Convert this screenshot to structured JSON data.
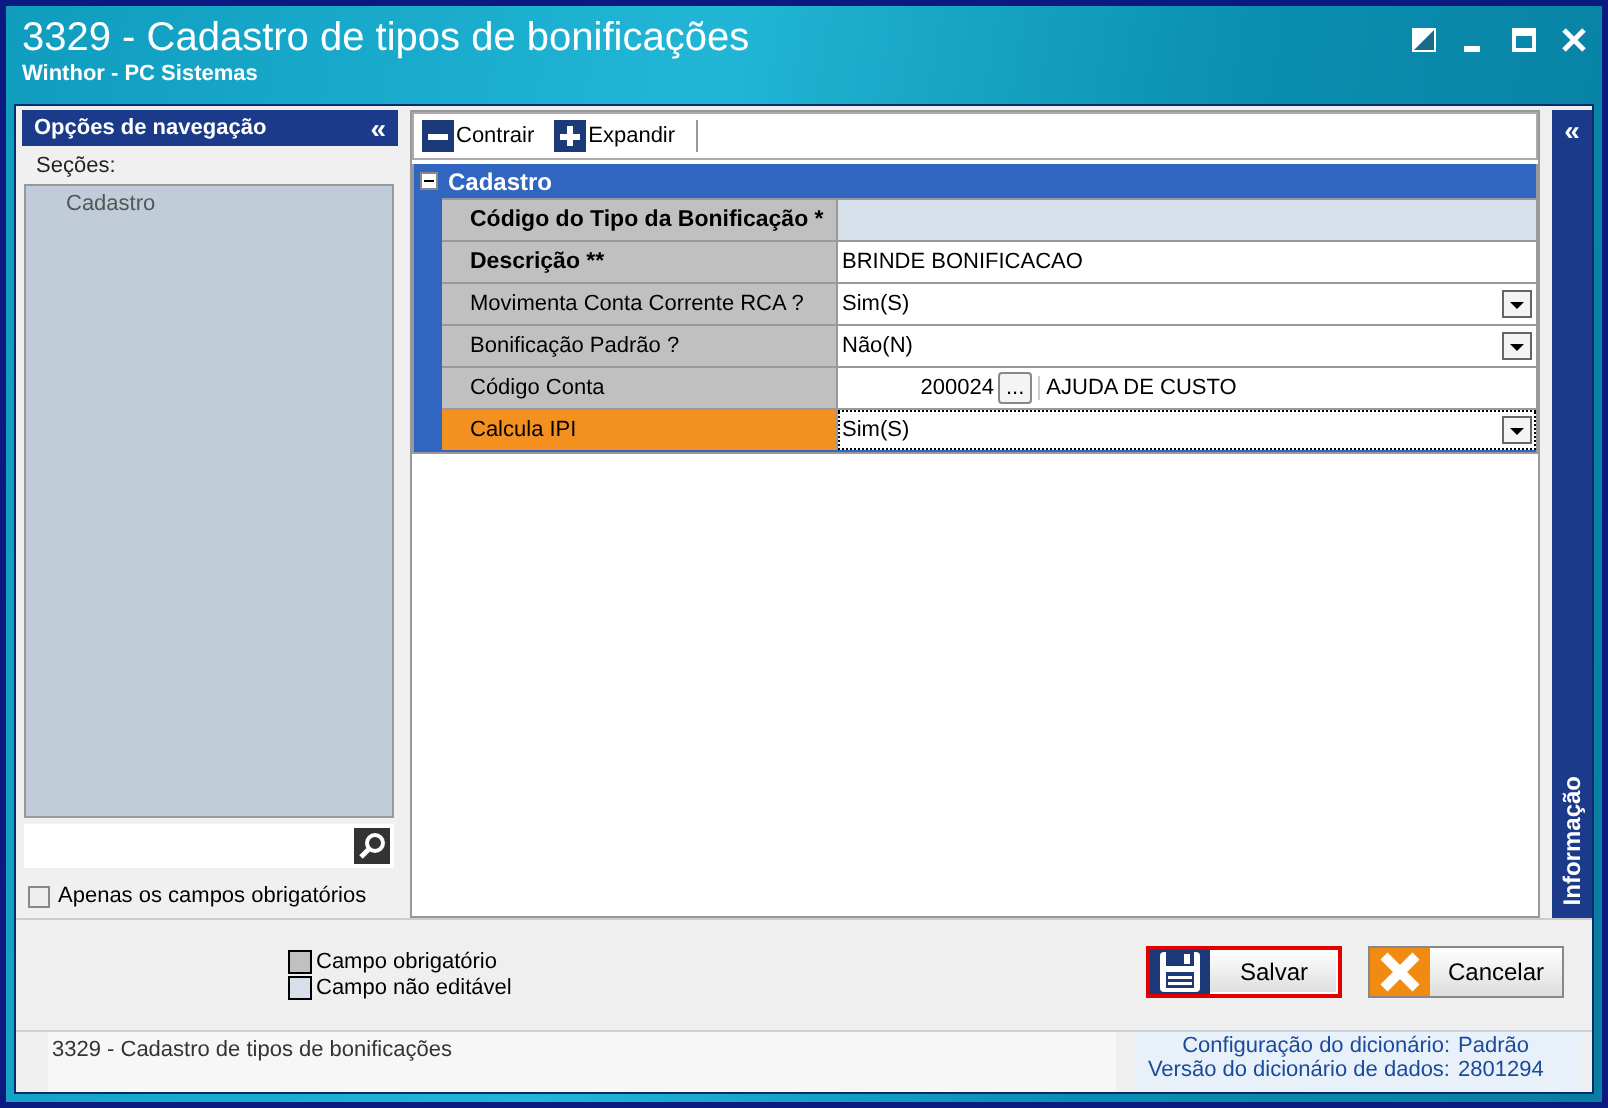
{
  "window": {
    "title": "3329 - Cadastro de tipos de bonificações",
    "subtitle": "Winthor - PC Sistemas"
  },
  "nav_panel": {
    "title": "Opções de navegação",
    "collapse": "«",
    "sections_label": "Seções:",
    "tree": [
      {
        "label": "Cadastro",
        "selected": false
      }
    ],
    "required_only": {
      "label": "Apenas os campos obrigatórios",
      "checked": false
    }
  },
  "toolbar": [
    {
      "label": "Contrair",
      "kind": "collapse"
    },
    {
      "label": "Expandir",
      "kind": "expand"
    }
  ],
  "group": {
    "title": "Cadastro",
    "expanded": true
  },
  "rows": [
    {
      "label": "Código do Tipo da Bonificação *",
      "required": true,
      "editable": false,
      "selected": false,
      "kind": "text"
    },
    {
      "label": "Descrição **",
      "value": "BRINDE BONIFICACAO",
      "required": true,
      "editable": true,
      "selected": false,
      "kind": "text"
    },
    {
      "label": "Movimenta Conta Corrente RCA ?",
      "value": "Sim(S)",
      "required": false,
      "editable": true,
      "selected": false,
      "kind": "select"
    },
    {
      "label": "Bonificação Padrão ?",
      "value": "Não(N)",
      "required": false,
      "editable": true,
      "selected": false,
      "kind": "select"
    },
    {
      "label": "Código Conta",
      "code": "200024",
      "button": "...",
      "value": "AJUDA DE CUSTO",
      "required": false,
      "editable": true,
      "selected": false,
      "kind": "lookup"
    },
    {
      "label": "Calcula IPI",
      "value": "Sim(S)",
      "required": false,
      "editable": true,
      "selected": true,
      "kind": "select"
    }
  ],
  "info_panel": {
    "title": "Informação",
    "collapse": "«"
  },
  "legend": [
    {
      "label": "Campo obrigatório",
      "color": "#c0c0c0"
    },
    {
      "label": "Campo não editável",
      "color": "#d6e0ea"
    }
  ],
  "buttons": [
    {
      "label": "Salvar",
      "kind": "save",
      "focused": true
    },
    {
      "label": "Cancelar",
      "kind": "cancel",
      "focused": false
    }
  ],
  "status_bar": {
    "text": "3329 - Cadastro de tipos de bonificações",
    "info": [
      {
        "label": "Configuração do dicionário:",
        "value": "Padrão"
      },
      {
        "label": "Versão do dicionário de dados:",
        "value": "2801294"
      }
    ]
  }
}
